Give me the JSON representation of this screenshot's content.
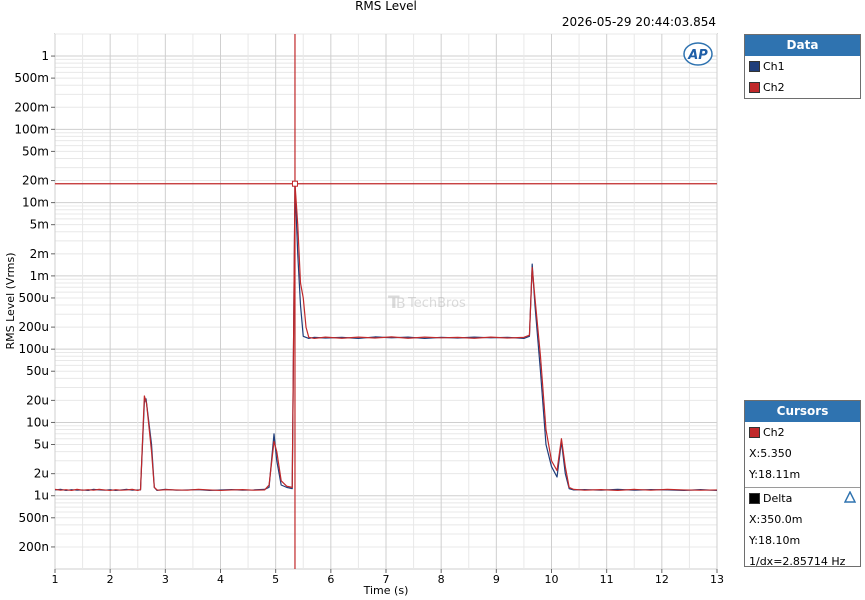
{
  "chart_data": {
    "type": "line",
    "title": "RMS Level",
    "timestamp": "2026-05-29 20:44:03.854",
    "logo": "AP",
    "watermark": "TechBros",
    "xlabel": "Time (s)",
    "ylabel": "RMS Level (Vrms)",
    "xlim": [
      1,
      13
    ],
    "ylim": [
      1e-07,
      2
    ],
    "yscale": "log",
    "grid": true,
    "x_ticks": [
      1,
      2,
      3,
      4,
      5,
      6,
      7,
      8,
      9,
      10,
      11,
      12,
      13
    ],
    "x_tick_labels": [
      "1",
      "2",
      "3",
      "4",
      "5",
      "6",
      "7",
      "8",
      "9",
      "10",
      "11",
      "12",
      "13"
    ],
    "y_ticks": [
      1,
      0.5,
      0.2,
      0.1,
      0.05,
      0.02,
      0.01,
      0.005,
      0.002,
      0.001,
      0.0005,
      0.0002,
      0.0001,
      5e-05,
      2e-05,
      1e-05,
      5e-06,
      2e-06,
      1e-06,
      5e-07,
      2e-07
    ],
    "y_tick_labels": [
      "1",
      "500m",
      "200m",
      "100m",
      "50m",
      "20m",
      "10m",
      "5m",
      "2m",
      "1m",
      "500u",
      "200u",
      "100u",
      "50u",
      "20u",
      "10u",
      "5u",
      "2u",
      "1u",
      "500n",
      "200n"
    ],
    "series": [
      {
        "name": "Ch1",
        "color": "#1f3d7a",
        "points": [
          [
            1.0,
            1.2e-06
          ],
          [
            1.1,
            1.22e-06
          ],
          [
            1.2,
            1.18e-06
          ],
          [
            1.3,
            1.21e-06
          ],
          [
            1.4,
            1.19e-06
          ],
          [
            1.5,
            1.2e-06
          ],
          [
            1.6,
            1.18e-06
          ],
          [
            1.7,
            1.22e-06
          ],
          [
            1.8,
            1.2e-06
          ],
          [
            1.9,
            1.19e-06
          ],
          [
            2.0,
            1.21e-06
          ],
          [
            2.1,
            1.18e-06
          ],
          [
            2.2,
            1.2e-06
          ],
          [
            2.3,
            1.22e-06
          ],
          [
            2.4,
            1.19e-06
          ],
          [
            2.5,
            1.2e-06
          ],
          [
            2.55,
            1.2e-06
          ],
          [
            2.62,
            1.9e-05
          ],
          [
            2.65,
            2.1e-05
          ],
          [
            2.75,
            5e-06
          ],
          [
            2.8,
            1.3e-06
          ],
          [
            2.85,
            1.18e-06
          ],
          [
            2.9,
            1.2e-06
          ],
          [
            3.0,
            1.22e-06
          ],
          [
            3.2,
            1.19e-06
          ],
          [
            3.4,
            1.2e-06
          ],
          [
            3.6,
            1.21e-06
          ],
          [
            3.8,
            1.18e-06
          ],
          [
            4.0,
            1.2e-06
          ],
          [
            4.2,
            1.21e-06
          ],
          [
            4.4,
            1.19e-06
          ],
          [
            4.6,
            1.2e-06
          ],
          [
            4.8,
            1.22e-06
          ],
          [
            4.88,
            1.3e-06
          ],
          [
            4.97,
            7e-06
          ],
          [
            5.02,
            3e-06
          ],
          [
            5.1,
            1.4e-06
          ],
          [
            5.2,
            1.3e-06
          ],
          [
            5.3,
            1.25e-06
          ],
          [
            5.35,
            0.018
          ],
          [
            5.4,
            0.002
          ],
          [
            5.45,
            0.0004
          ],
          [
            5.5,
            0.00015
          ],
          [
            5.6,
            0.00014
          ],
          [
            5.7,
            0.000145
          ],
          [
            5.9,
            0.000142
          ],
          [
            6.2,
            0.000145
          ],
          [
            6.5,
            0.00014
          ],
          [
            6.8,
            0.000147
          ],
          [
            7.1,
            0.000143
          ],
          [
            7.4,
            0.000146
          ],
          [
            7.7,
            0.00014
          ],
          [
            8.0,
            0.000145
          ],
          [
            8.3,
            0.000142
          ],
          [
            8.6,
            0.000146
          ],
          [
            8.9,
            0.000143
          ],
          [
            9.2,
            0.000145
          ],
          [
            9.5,
            0.00014
          ],
          [
            9.6,
            0.00015
          ],
          [
            9.65,
            0.00145
          ],
          [
            9.7,
            0.0004
          ],
          [
            9.8,
            5e-05
          ],
          [
            9.9,
            5e-06
          ],
          [
            10.0,
            2.5e-06
          ],
          [
            10.1,
            1.8e-06
          ],
          [
            10.18,
            5.5e-06
          ],
          [
            10.25,
            2e-06
          ],
          [
            10.32,
            1.25e-06
          ],
          [
            10.4,
            1.2e-06
          ],
          [
            10.6,
            1.21e-06
          ],
          [
            10.9,
            1.19e-06
          ],
          [
            11.2,
            1.22e-06
          ],
          [
            11.5,
            1.19e-06
          ],
          [
            11.8,
            1.21e-06
          ],
          [
            12.1,
            1.2e-06
          ],
          [
            12.4,
            1.18e-06
          ],
          [
            12.7,
            1.21e-06
          ],
          [
            13.0,
            1.18e-06
          ]
        ]
      },
      {
        "name": "Ch2",
        "color": "#c0282a",
        "points": [
          [
            1.0,
            1.22e-06
          ],
          [
            1.1,
            1.19e-06
          ],
          [
            1.2,
            1.21e-06
          ],
          [
            1.3,
            1.18e-06
          ],
          [
            1.4,
            1.22e-06
          ],
          [
            1.5,
            1.19e-06
          ],
          [
            1.6,
            1.21e-06
          ],
          [
            1.7,
            1.19e-06
          ],
          [
            1.8,
            1.22e-06
          ],
          [
            1.9,
            1.2e-06
          ],
          [
            2.0,
            1.18e-06
          ],
          [
            2.1,
            1.21e-06
          ],
          [
            2.2,
            1.19e-06
          ],
          [
            2.3,
            1.2e-06
          ],
          [
            2.4,
            1.22e-06
          ],
          [
            2.5,
            1.18e-06
          ],
          [
            2.55,
            1.21e-06
          ],
          [
            2.62,
            2.3e-05
          ],
          [
            2.66,
            1.8e-05
          ],
          [
            2.75,
            4e-06
          ],
          [
            2.8,
            1.3e-06
          ],
          [
            2.85,
            1.2e-06
          ],
          [
            2.9,
            1.19e-06
          ],
          [
            3.0,
            1.21e-06
          ],
          [
            3.2,
            1.2e-06
          ],
          [
            3.4,
            1.19e-06
          ],
          [
            3.6,
            1.22e-06
          ],
          [
            3.8,
            1.2e-06
          ],
          [
            4.0,
            1.18e-06
          ],
          [
            4.2,
            1.2e-06
          ],
          [
            4.4,
            1.21e-06
          ],
          [
            4.6,
            1.19e-06
          ],
          [
            4.8,
            1.2e-06
          ],
          [
            4.88,
            1.4e-06
          ],
          [
            4.97,
            5.5e-06
          ],
          [
            5.02,
            4e-06
          ],
          [
            5.1,
            1.6e-06
          ],
          [
            5.2,
            1.35e-06
          ],
          [
            5.3,
            1.3e-06
          ],
          [
            5.35,
            0.01811
          ],
          [
            5.4,
            0.005
          ],
          [
            5.45,
            0.0008
          ],
          [
            5.5,
            0.0005
          ],
          [
            5.55,
            0.0002
          ],
          [
            5.6,
            0.000145
          ],
          [
            5.7,
            0.00014
          ],
          [
            5.9,
            0.000146
          ],
          [
            6.2,
            0.000141
          ],
          [
            6.5,
            0.000146
          ],
          [
            6.8,
            0.000142
          ],
          [
            7.1,
            0.000147
          ],
          [
            7.4,
            0.000141
          ],
          [
            7.7,
            0.000146
          ],
          [
            8.0,
            0.000143
          ],
          [
            8.3,
            0.000145
          ],
          [
            8.6,
            0.000141
          ],
          [
            8.9,
            0.000146
          ],
          [
            9.2,
            0.000142
          ],
          [
            9.5,
            0.000145
          ],
          [
            9.6,
            0.000155
          ],
          [
            9.65,
            0.0013
          ],
          [
            9.7,
            0.0005
          ],
          [
            9.8,
            8e-05
          ],
          [
            9.9,
            8e-06
          ],
          [
            10.0,
            3e-06
          ],
          [
            10.1,
            2.2e-06
          ],
          [
            10.18,
            6e-06
          ],
          [
            10.25,
            2.5e-06
          ],
          [
            10.32,
            1.3e-06
          ],
          [
            10.4,
            1.22e-06
          ],
          [
            10.6,
            1.19e-06
          ],
          [
            10.9,
            1.21e-06
          ],
          [
            11.2,
            1.18e-06
          ],
          [
            11.5,
            1.22e-06
          ],
          [
            11.8,
            1.19e-06
          ],
          [
            12.1,
            1.22e-06
          ],
          [
            12.4,
            1.2e-06
          ],
          [
            12.7,
            1.19e-06
          ],
          [
            13.0,
            1.2e-06
          ]
        ]
      }
    ],
    "cursor": {
      "x": 5.35,
      "y": 0.01811,
      "color": "#c0282a"
    }
  },
  "data_panel": {
    "title": "Data",
    "items": [
      {
        "label": "Ch1",
        "color": "#1f3d7a"
      },
      {
        "label": "Ch2",
        "color": "#c0282a"
      }
    ]
  },
  "cursors_panel": {
    "title": "Cursors",
    "ch_label": "Ch2",
    "ch_color": "#c0282a",
    "x_text": "X:5.350",
    "y_text": "Y:18.11m",
    "delta_label": "Delta",
    "delta_color": "#000000",
    "dx_text": "X:350.0m",
    "dy_text": "Y:18.10m",
    "inv_dx_text": "1/dx=2.85714 Hz"
  }
}
